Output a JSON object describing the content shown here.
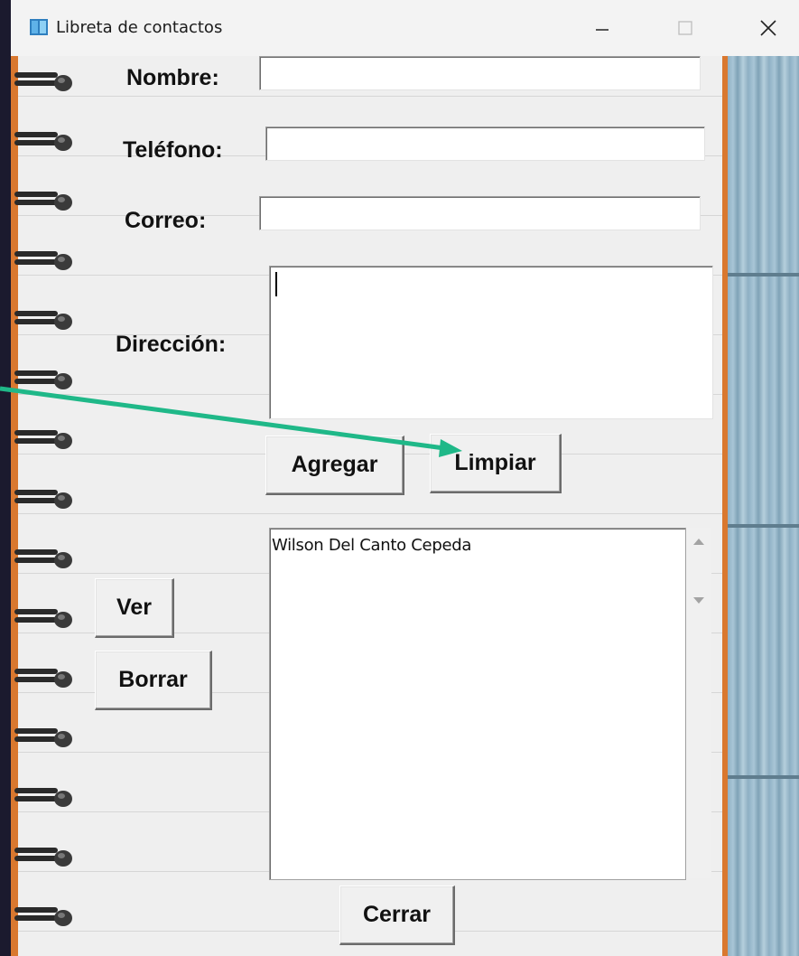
{
  "window": {
    "title": "Libreta de contactos"
  },
  "form": {
    "nombre_label": "Nombre:",
    "nombre_value": "",
    "telefono_label": "Teléfono:",
    "telefono_value": "",
    "correo_label": "Correo:",
    "correo_value": "",
    "direccion_label": "Dirección:",
    "direccion_value": ""
  },
  "buttons": {
    "agregar": "Agregar",
    "limpiar": "Limpiar",
    "ver": "Ver",
    "borrar": "Borrar",
    "cerrar": "Cerrar"
  },
  "contacts": {
    "items": [
      "Wilson Del Canto Cepeda"
    ]
  },
  "annotation": {
    "arrow_color": "#1fb888"
  },
  "colors": {
    "paper_edge": "#d9782f",
    "wood": "#9fbccc"
  }
}
